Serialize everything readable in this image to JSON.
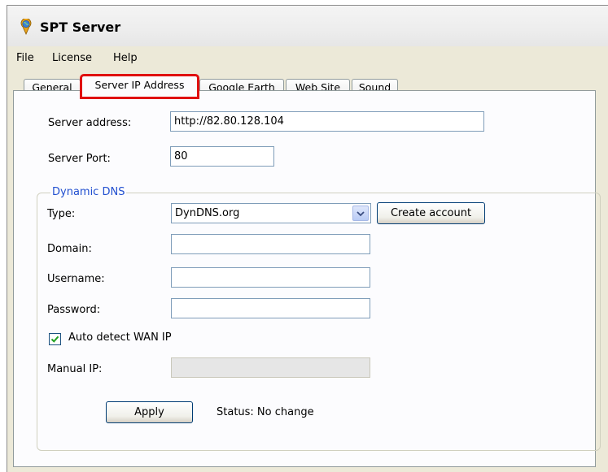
{
  "window": {
    "title": "SPT Server",
    "icon": "globe-pin-icon"
  },
  "menu": [
    "File",
    "License",
    "Help"
  ],
  "tabs": [
    {
      "label": "General",
      "active": false
    },
    {
      "label": "Server IP Address",
      "active": true
    },
    {
      "label": "Google Earth",
      "active": false
    },
    {
      "label": "Web Site",
      "active": false
    },
    {
      "label": "Sound",
      "active": false
    }
  ],
  "server": {
    "address_label": "Server address:",
    "address_value": "http://82.80.128.104",
    "port_label": "Server Port:",
    "port_value": "80"
  },
  "dns": {
    "group_title": "Dynamic DNS",
    "type_label": "Type:",
    "type_value": "DynDNS.org",
    "create_account_label": "Create account",
    "domain_label": "Domain:",
    "domain_value": "",
    "username_label": "Username:",
    "username_value": "",
    "password_label": "Password:",
    "password_value": "",
    "auto_detect_label": "Auto detect WAN IP",
    "auto_detect_checked": true,
    "manual_ip_label": "Manual IP:",
    "manual_ip_value": "",
    "apply_label": "Apply",
    "status_text": "Status: No change"
  },
  "colors": {
    "highlight": "#e01010",
    "group_title": "#2250d0"
  }
}
